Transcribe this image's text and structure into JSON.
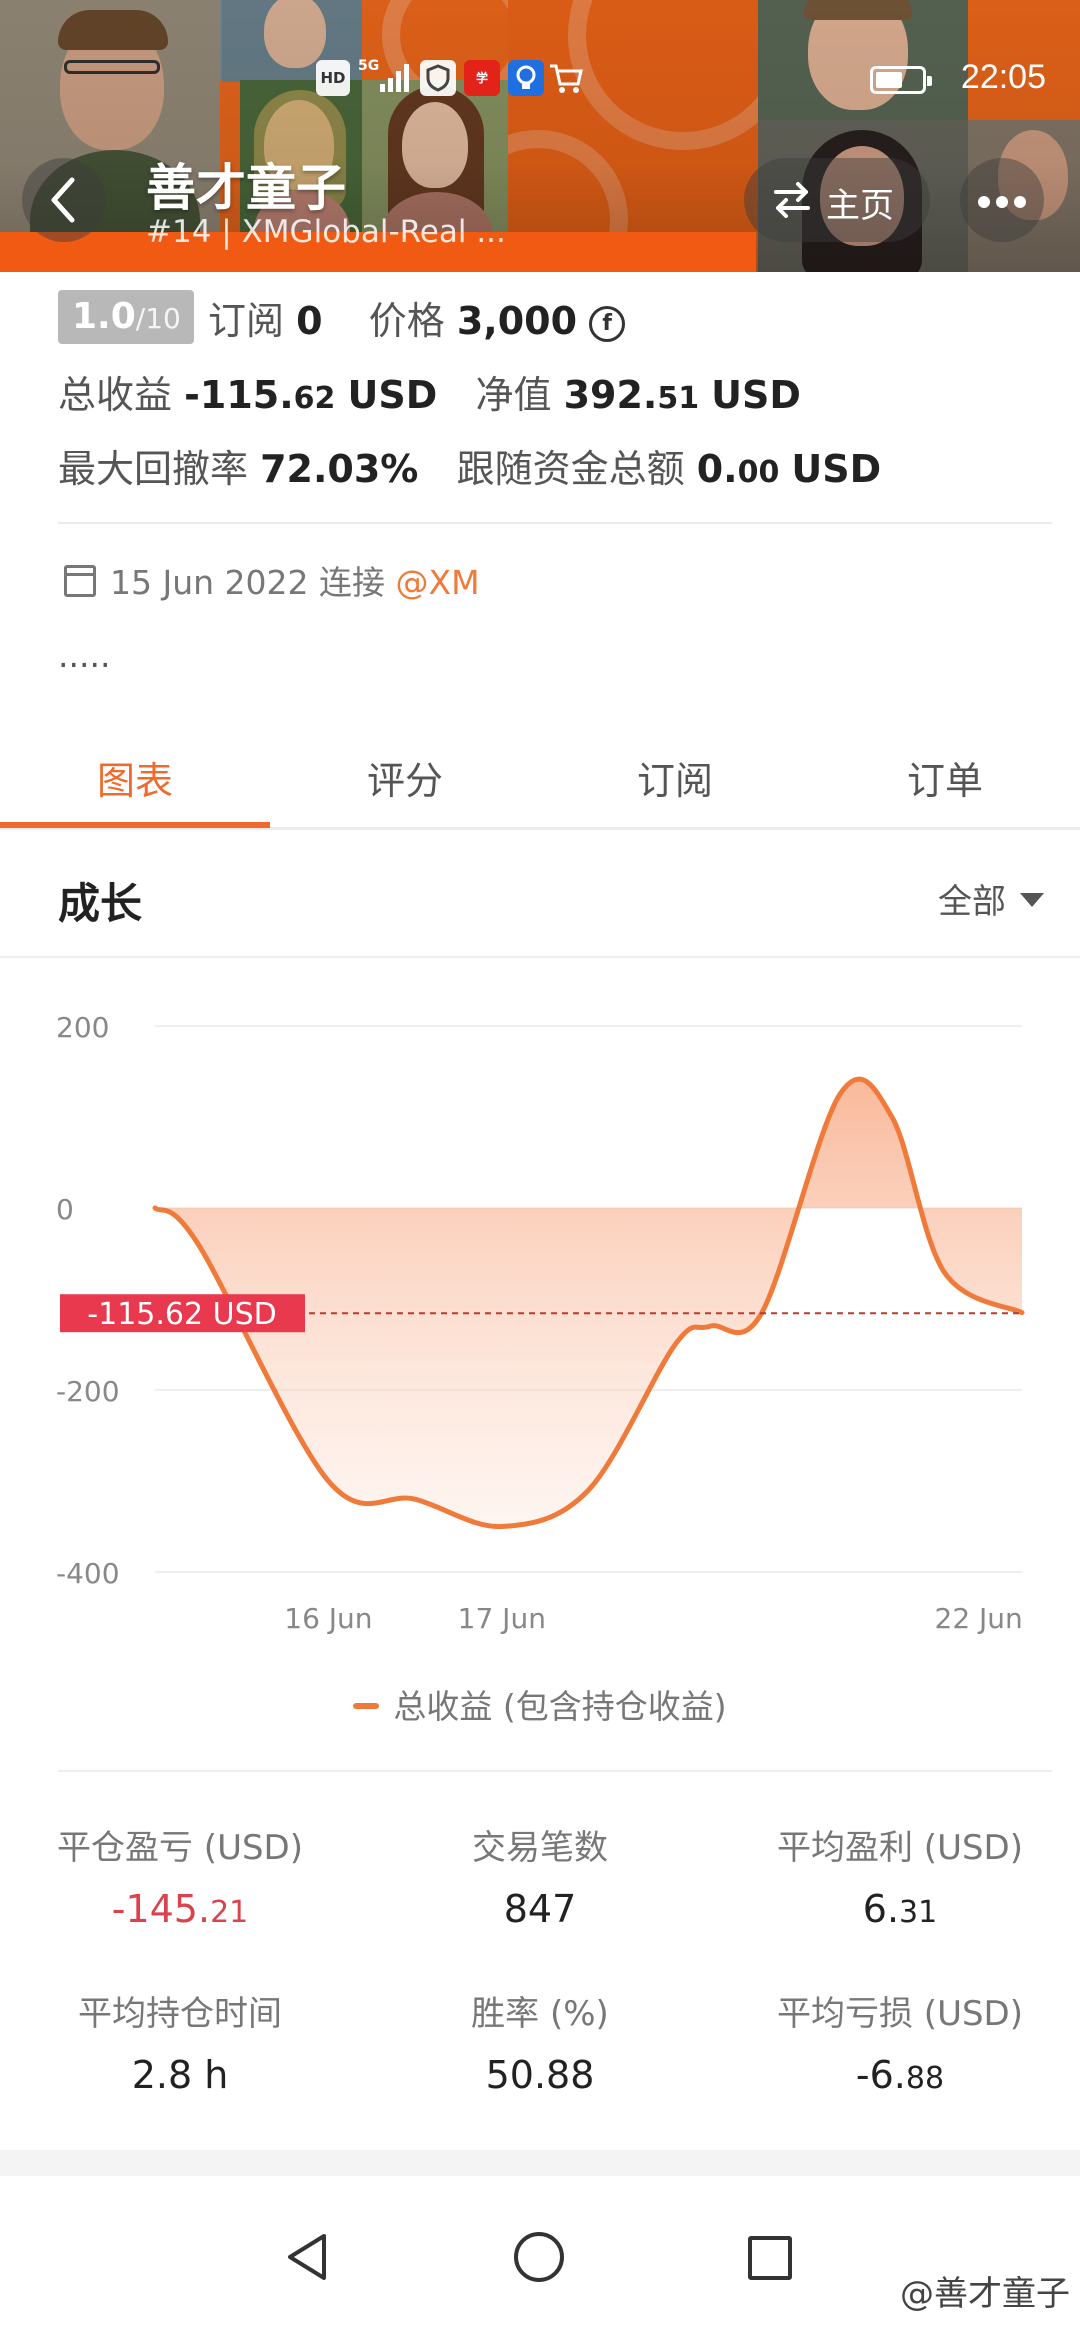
{
  "status_bar": {
    "icons": [
      "HD",
      "5G",
      "signal-icon",
      "shield-app-icon",
      "xuexi-app-icon",
      "bulb-app-icon",
      "cart-app-icon"
    ],
    "hd_label": "HD",
    "net_label": "5G",
    "time": "22:05"
  },
  "header": {
    "title": "善才童子",
    "subtitle": "#14 | XMGlobal-Real ...",
    "home_label": "主页",
    "accent": "#f26b1d"
  },
  "profile": {
    "rating_score": "1.0",
    "rating_den": "/10",
    "subscribe_label": "订阅",
    "subscribe_count": "0",
    "price_label": "价格",
    "price_value": "3,000",
    "coin_symbol": "f",
    "total_label": "总收益",
    "total_int": "-115.",
    "total_dec": "62",
    "total_unit": "USD",
    "equity_label": "净值",
    "equity_int": "392.",
    "equity_dec": "51",
    "equity_unit": "USD",
    "drawdown_label": "最大回撤率",
    "drawdown_value": "72.03%",
    "follow_label": "跟随资金总额",
    "follow_int": "0.",
    "follow_dec": "00",
    "follow_unit": "USD",
    "connect_date": "15 Jun 2022",
    "connect_label": "连接",
    "connect_broker": "@XM",
    "description": "....."
  },
  "tabs": [
    {
      "label": "图表",
      "active": true
    },
    {
      "label": "评分",
      "active": false
    },
    {
      "label": "订阅",
      "active": false
    },
    {
      "label": "订单",
      "active": false
    }
  ],
  "section": {
    "title": "成长",
    "range_label": "全部"
  },
  "chart_data": {
    "type": "area",
    "series": [
      {
        "name": "总收益 (包含持仓收益)",
        "x_frac": [
          0,
          0.05,
          0.2,
          0.3,
          0.4,
          0.5,
          0.6,
          0.64,
          0.7,
          0.79,
          0.85,
          0.91,
          1
        ],
        "values": [
          0,
          -40,
          -300,
          -320,
          -350,
          -310,
          -150,
          -130,
          -115,
          125,
          100,
          -70,
          -115
        ]
      }
    ],
    "x_ticks": [
      {
        "label": "16 Jun",
        "frac": 0.2
      },
      {
        "label": "17 Jun",
        "frac": 0.4
      },
      {
        "label": "22 Jun",
        "frac": 0.95
      }
    ],
    "y_ticks": [
      200,
      0,
      -200,
      -400
    ],
    "ylim": [
      -400,
      200
    ],
    "current_value": -115.62,
    "current_label": "-115.62 USD",
    "grid": true,
    "colors": {
      "line": "#f07a3a",
      "marker_bg": "#e8394f",
      "dashed": "#c0392b"
    }
  },
  "legend_label": "总收益 (包含持仓收益)",
  "stats": [
    {
      "label": "平仓盈亏 (USD)",
      "int": "-145.",
      "dec": "21",
      "negative": true
    },
    {
      "label": "交易笔数",
      "int": "847",
      "dec": "",
      "negative": false
    },
    {
      "label": "平均盈利 (USD)",
      "int": "6.",
      "dec": "31",
      "negative": false
    },
    {
      "label": "平均持仓时间",
      "int": "2.8 h",
      "dec": "",
      "negative": false
    },
    {
      "label": "胜率 (%)",
      "int": "50.88",
      "dec": "",
      "negative": false
    },
    {
      "label": "平均亏损 (USD)",
      "int": "-6.",
      "dec": "88",
      "negative": false
    }
  ],
  "navbar": {
    "watermark": "@善才童子"
  }
}
